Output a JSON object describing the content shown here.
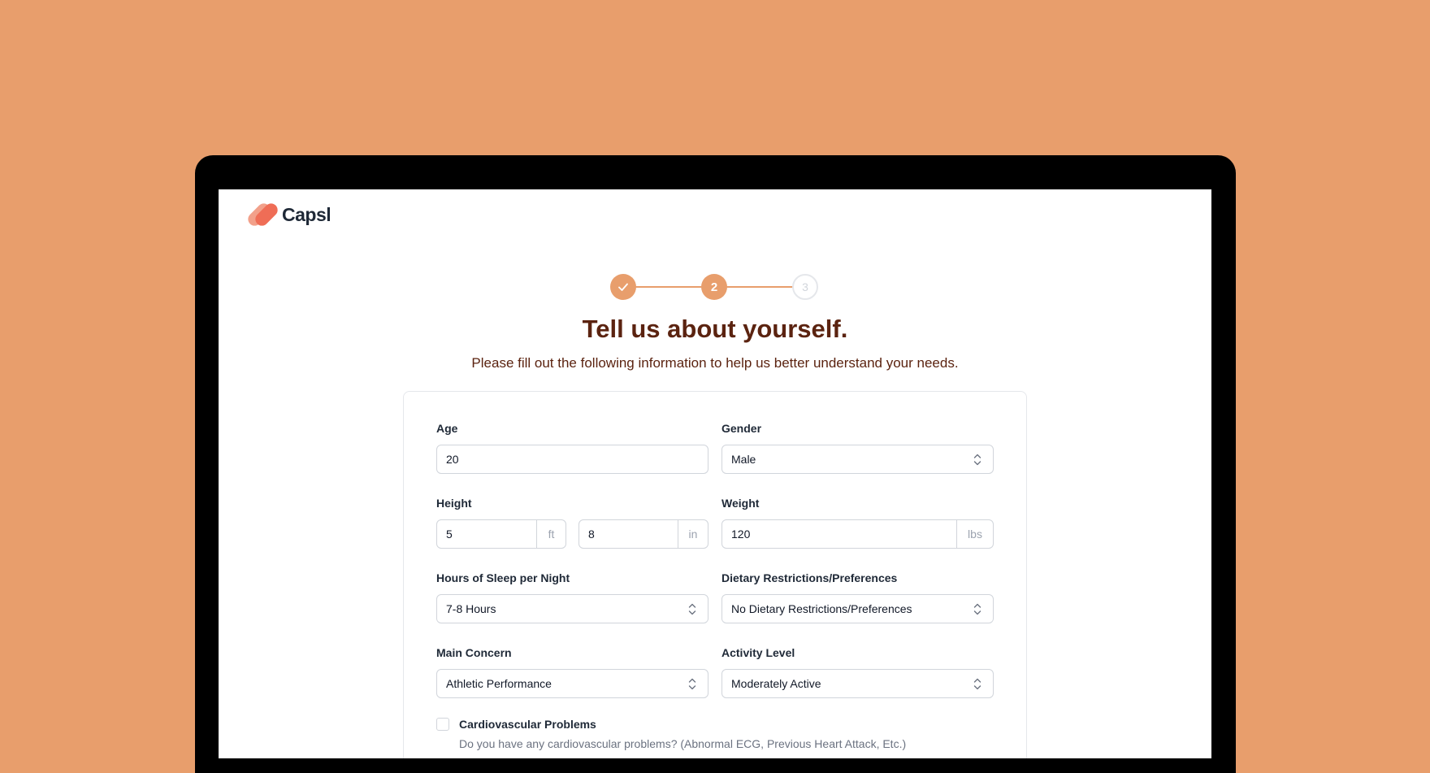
{
  "brand": {
    "name": "Capsl"
  },
  "stepper": {
    "steps": [
      {
        "label": "",
        "state": "completed",
        "icon": "check-icon"
      },
      {
        "label": "2",
        "state": "current"
      },
      {
        "label": "3",
        "state": "upcoming"
      }
    ]
  },
  "header": {
    "title": "Tell us about yourself.",
    "subtitle": "Please fill out the following information to help us better understand your needs."
  },
  "form": {
    "age": {
      "label": "Age",
      "value": "20"
    },
    "gender": {
      "label": "Gender",
      "value": "Male"
    },
    "height": {
      "label": "Height",
      "feet": "5",
      "feet_unit": "ft",
      "inches": "8",
      "inches_unit": "in"
    },
    "weight": {
      "label": "Weight",
      "value": "120",
      "unit": "lbs"
    },
    "sleep": {
      "label": "Hours of Sleep per Night",
      "value": "7-8 Hours"
    },
    "diet": {
      "label": "Dietary Restrictions/Preferences",
      "value": "No Dietary Restrictions/Preferences"
    },
    "concern": {
      "label": "Main Concern",
      "value": "Athletic Performance"
    },
    "activity": {
      "label": "Activity Level",
      "value": "Moderately Active"
    },
    "cardio": {
      "label": "Cardiovascular Problems",
      "description": "Do you have any cardiovascular problems? (Abnormal ECG, Previous Heart Attack, Etc.)",
      "checked": false
    }
  },
  "colors": {
    "background": "#e89e6c",
    "accent": "#e89e6c",
    "heading": "#5b2310",
    "logo_light": "#f2a08a",
    "logo_dark": "#ef6d56"
  }
}
